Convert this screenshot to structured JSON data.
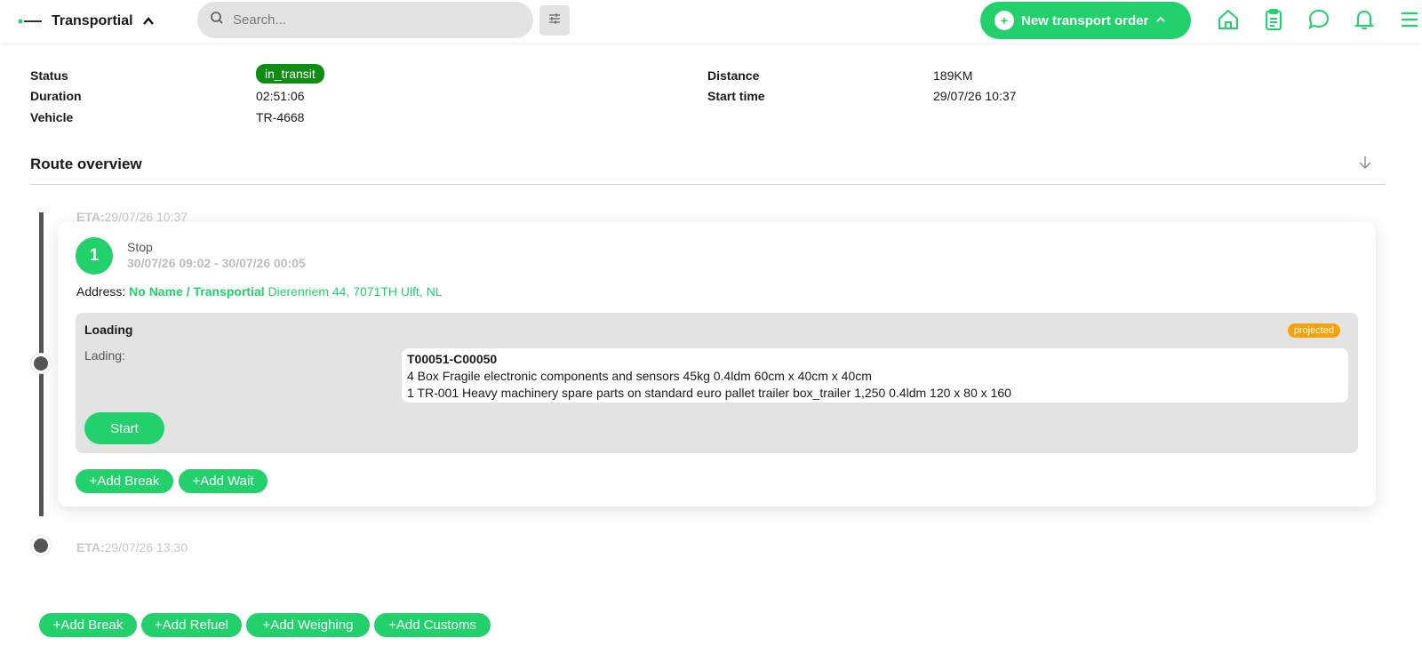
{
  "header": {
    "brand": "Transportial",
    "search_placeholder": "Search...",
    "new_order_label": "New transport order",
    "icons": [
      "home-icon",
      "clipboard-icon",
      "chat-icon",
      "bell-icon",
      "menu-icon"
    ]
  },
  "trip": {
    "status_label": "Status",
    "status_value": "in_transit",
    "duration_label": "Duration",
    "duration_value": "02:51:06",
    "vehicle_label": "Vehicle",
    "vehicle_value": "TR-4668",
    "distance_label": "Distance",
    "distance_value": "189KM",
    "start_time_label": "Start time",
    "start_time_value": "29/07/26 10:37"
  },
  "route": {
    "title": "Route overview",
    "eta_label": "ETA:",
    "eta_first": "29/07/26 10:37",
    "eta_last": "29/07/26 13:30",
    "stop": {
      "number": "1",
      "type": "Stop",
      "time_window": "30/07/26 09:02 - 30/07/26 00:05",
      "address_label": "Address:",
      "address_name": "No Name / Transportial",
      "address_street": "Dierenriem 44, 7071TH Ulft, NL",
      "action": {
        "title": "Loading",
        "badge": "projected",
        "lading_label": "Lading:",
        "lading_id": "T00051-C00050",
        "lading_lines": [
          "4 Box Fragile electronic components and sensors 45kg 0.4ldm 60cm x 40cm x 40cm",
          "1 TR-001 Heavy machinery spare parts on standard euro pallet trailer box_trailer 1,250 0.4ldm 120 x 80 x 160"
        ],
        "start_label": "Start"
      },
      "add_break_label": "+Add Break",
      "add_wait_label": "+Add Wait"
    },
    "bottom_actions": [
      "+Add Break",
      "+Add Refuel",
      "+Add Weighing",
      "+Add Customs"
    ]
  },
  "colors": {
    "accent": "#22d16c",
    "status_green": "#108c15",
    "projected": "#f5a20a"
  }
}
